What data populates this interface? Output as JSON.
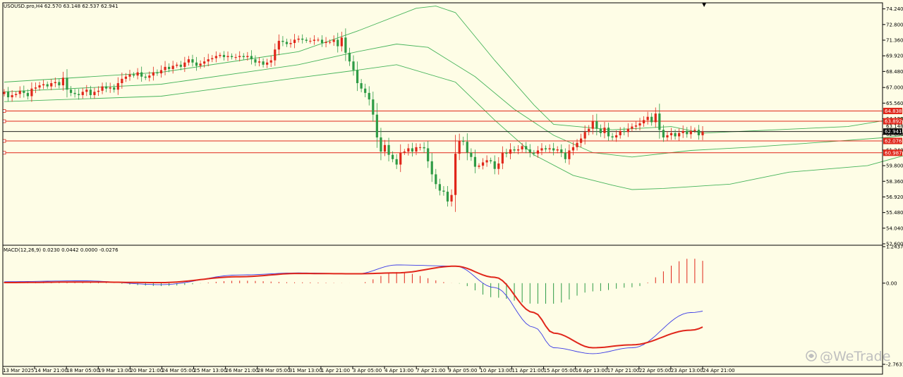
{
  "window": {
    "symbol_line": "USOUSD.pro,H4  62.570 63.148 62.537 62.941",
    "watermark": "@WeTrade",
    "top_marker": "▼"
  },
  "colors": {
    "background": "#fefde6",
    "bull": "#2e9b45",
    "bear": "#e0261a",
    "band": "#46b45a",
    "level": "#e0261a",
    "price_line": "#000000",
    "macd_line": "#3a3ae6",
    "signal_line": "#e0261a",
    "hist_pos": "#e0261a",
    "hist_neg": "#2e9b45",
    "grid": "#000000"
  },
  "icons": {
    "watermark_logo": "wetrade-logo-icon"
  },
  "chart_data": [
    {
      "type": "candlestick",
      "name": "price",
      "ylim": [
        52.6,
        74.8
      ],
      "yticks": [
        "74.240",
        "72.800",
        "71.360",
        "69.920",
        "68.480",
        "67.000",
        "65.560",
        "64.120",
        "62.680",
        "61.240",
        "59.800",
        "58.360",
        "56.920",
        "55.480",
        "54.040",
        "52.600"
      ],
      "xticks": [
        "13 Mar 2025",
        "14 Mar 21:00",
        "18 Mar 05:00",
        "19 Mar 13:00",
        "20 Mar 21:00",
        "24 Mar 05:00",
        "25 Mar 13:00",
        "26 Mar 21:00",
        "28 Mar 05:00",
        "31 Mar 13:00",
        "1 Apr 21:00",
        "3 Apr 05:00",
        "4 Apr 13:00",
        "7 Apr 21:00",
        "9 Apr 05:00",
        "10 Apr 13:00",
        "11 Apr 21:00",
        "15 Apr 05:00",
        "16 Apr 13:00",
        "17 Apr 21:00",
        "22 Apr 05:00",
        "23 Apr 13:00",
        "24 Apr 21:00"
      ],
      "closes": [
        66.6,
        66.1,
        66.3,
        66.4,
        66.7,
        66.5,
        66.2,
        66.9,
        67.0,
        67.2,
        67.3,
        67.1,
        67.4,
        67.5,
        67.2,
        67.9,
        66.8,
        66.5,
        66.4,
        66.3,
        66.6,
        66.8,
        66.3,
        66.6,
        66.7,
        67.1,
        66.9,
        67.0,
        66.8,
        67.4,
        67.8,
        68.0,
        68.2,
        68.1,
        68.4,
        68.0,
        67.9,
        68.1,
        68.4,
        68.3,
        68.6,
        68.9,
        68.7,
        69.0,
        69.1,
        68.9,
        69.3,
        69.6,
        69.3,
        69.0,
        69.2,
        69.4,
        69.6,
        69.7,
        69.9,
        70.0,
        69.8,
        69.9,
        69.8,
        69.8,
        69.9,
        69.8,
        69.9,
        69.6,
        69.3,
        69.4,
        69.1,
        69.3,
        69.5,
        70.5,
        71.3,
        71.2,
        71.0,
        71.1,
        71.4,
        71.5,
        71.4,
        71.3,
        71.3,
        71.4,
        71.4,
        71.1,
        71.2,
        71.2,
        71.4,
        70.8,
        71.6,
        70.2,
        69.4,
        68.6,
        67.4,
        66.9,
        66.5,
        65.9,
        64.5,
        62.4,
        61.1,
        61.7,
        60.8,
        60.4,
        59.9,
        61.0,
        61.1,
        61.4,
        61.1,
        61.5,
        61.5,
        61.4,
        60.2,
        59.0,
        58.1,
        57.5,
        57.4,
        56.5,
        57.1,
        60.9,
        62.1,
        62.0,
        61.0,
        60.6,
        59.7,
        59.8,
        60.1,
        60.3,
        60.2,
        59.5,
        60.0,
        61.0,
        60.9,
        61.3,
        61.2,
        61.3,
        61.6,
        61.3,
        61.0,
        60.9,
        61.2,
        61.4,
        61.3,
        61.4,
        61.2,
        61.3,
        61.0,
        60.4,
        61.2,
        61.5,
        61.9,
        62.3,
        62.9,
        63.2,
        63.9,
        63.2,
        62.8,
        63.3,
        62.5,
        62.4,
        62.6,
        63.0,
        62.9,
        63.2,
        63.4,
        63.5,
        63.7,
        64.0,
        64.3,
        63.8,
        64.6,
        63.1,
        62.4,
        62.6,
        62.8,
        62.5,
        62.8,
        63.0,
        62.7,
        63.0,
        63.1,
        62.6,
        62.94
      ],
      "bands": {
        "upper": [
          [
            0,
            67.5
          ],
          [
            40,
            68.4
          ],
          [
            75,
            70.3
          ],
          [
            90,
            72.2
          ],
          [
            105,
            74.3
          ],
          [
            110,
            74.5
          ],
          [
            115,
            73.9
          ],
          [
            125,
            69.5
          ],
          [
            135,
            65.4
          ],
          [
            140,
            63.6
          ],
          [
            155,
            63.1
          ],
          [
            170,
            63.4
          ],
          [
            178,
            62.8
          ],
          [
            190,
            63.0
          ],
          [
            215,
            63.4
          ],
          [
            230,
            64.3
          ],
          [
            245,
            64.1
          ],
          [
            260,
            64.0
          ]
        ],
        "middle": [
          [
            0,
            66.6
          ],
          [
            40,
            67.3
          ],
          [
            75,
            69.1
          ],
          [
            90,
            70.3
          ],
          [
            100,
            71.0
          ],
          [
            108,
            70.7
          ],
          [
            120,
            68.0
          ],
          [
            130,
            65.0
          ],
          [
            140,
            62.6
          ],
          [
            150,
            61.0
          ],
          [
            160,
            60.6
          ],
          [
            175,
            61.2
          ],
          [
            190,
            61.5
          ],
          [
            210,
            62.0
          ],
          [
            225,
            62.4
          ],
          [
            245,
            63.2
          ],
          [
            260,
            63.0
          ]
        ],
        "lower": [
          [
            0,
            65.7
          ],
          [
            40,
            66.2
          ],
          [
            75,
            67.9
          ],
          [
            90,
            68.6
          ],
          [
            100,
            69.1
          ],
          [
            115,
            67.5
          ],
          [
            125,
            64.0
          ],
          [
            135,
            60.8
          ],
          [
            145,
            58.9
          ],
          [
            155,
            58.0
          ],
          [
            160,
            57.6
          ],
          [
            168,
            57.7
          ],
          [
            185,
            58.1
          ],
          [
            200,
            59.2
          ],
          [
            220,
            59.8
          ],
          [
            240,
            61.8
          ],
          [
            260,
            61.7
          ]
        ]
      },
      "levels": [
        {
          "value": 64.838,
          "label": "64.838"
        },
        {
          "value": 63.892,
          "label": "63.892"
        },
        {
          "value": 62.076,
          "label": "62.076"
        },
        {
          "value": 60.987,
          "label": "60.987"
        }
      ],
      "current": {
        "value": 62.941,
        "label": "62.941"
      },
      "current_high_label": "63.148"
    },
    {
      "type": "line",
      "name": "MACD",
      "title": "MACD(12,26,9) 0.0230 0.0442 0.0000 -0.0276",
      "ylim": [
        -2.7631,
        1.2437
      ],
      "yticks": [
        "1.2437",
        "0.00",
        "-2.7631"
      ],
      "x": [
        0,
        20,
        40,
        60,
        75,
        90,
        100,
        115,
        125,
        135,
        140,
        150,
        160,
        175,
        190,
        205,
        225,
        240,
        250,
        260
      ],
      "macd": [
        0.05,
        0.08,
        -0.05,
        0.28,
        0.35,
        0.32,
        0.62,
        0.58,
        -0.15,
        -1.5,
        -2.2,
        -2.4,
        -2.2,
        -1.0,
        -0.5,
        0.0,
        0.02,
        0.55,
        0.45,
        0.05
      ],
      "signal": [
        0.02,
        0.04,
        0.02,
        0.22,
        0.33,
        0.32,
        0.35,
        0.58,
        0.2,
        -1.0,
        -1.7,
        -2.2,
        -2.1,
        -1.6,
        -0.5,
        -0.05,
        0.05,
        0.45,
        0.48,
        0.05
      ]
    }
  ]
}
